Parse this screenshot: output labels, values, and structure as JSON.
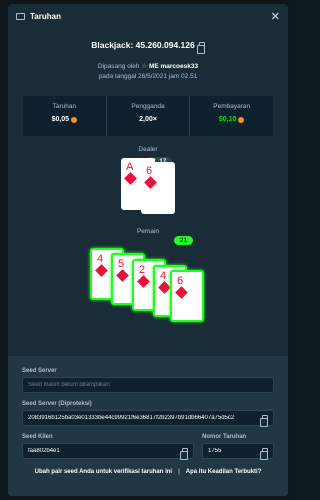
{
  "header": {
    "title": "Taruhan"
  },
  "bet": {
    "title": "Blackjack: 45.260.094.126",
    "placed_by_prefix": "Dipasang oleh",
    "placed_by_user": "ME marcoesk33",
    "placed_on": "pada tanggal 26/5/2021 jam 02.51"
  },
  "stats": [
    {
      "label": "Taruhan",
      "value": "$0,05",
      "coin": true
    },
    {
      "label": "Pengganda",
      "value": "2,00×",
      "coin": false
    },
    {
      "label": "Pembayaran",
      "value": "$0,10",
      "coin": true
    }
  ],
  "game": {
    "dealer_label": "Dealer",
    "dealer_score": "7, 17",
    "player_label": "Pemain",
    "player_score": "21",
    "dealer_cards": [
      {
        "rank": "A"
      },
      {
        "rank": "6"
      }
    ],
    "player_cards": [
      {
        "rank": "4"
      },
      {
        "rank": "5"
      },
      {
        "rank": "2"
      },
      {
        "rank": "4"
      },
      {
        "rank": "6"
      }
    ]
  },
  "fairness": {
    "seed_server_label": "Seed Server",
    "seed_server_placeholder": "Seed masih belum ditampilkan",
    "seed_server_hashed_label": "Seed Server (Diproteksi)",
    "seed_server_hashed": "2083916b125ba03e01333be44c99921f6e36817f2b2397b91db66407a75d5c2",
    "client_seed_label": "Seed Klien",
    "client_seed": "faa802b4e1",
    "nonce_label": "Nomor Taruhan",
    "nonce": "1755",
    "change_seed_link": "Ubah pair seed Anda untuk verifikasi taruhan ini",
    "separator": "|",
    "fair_link": "Apa itu Keadilan Terbukti?"
  },
  "colors": {
    "win": "#1fff20",
    "card_red": "#e9113c",
    "payout": "#00e701"
  }
}
